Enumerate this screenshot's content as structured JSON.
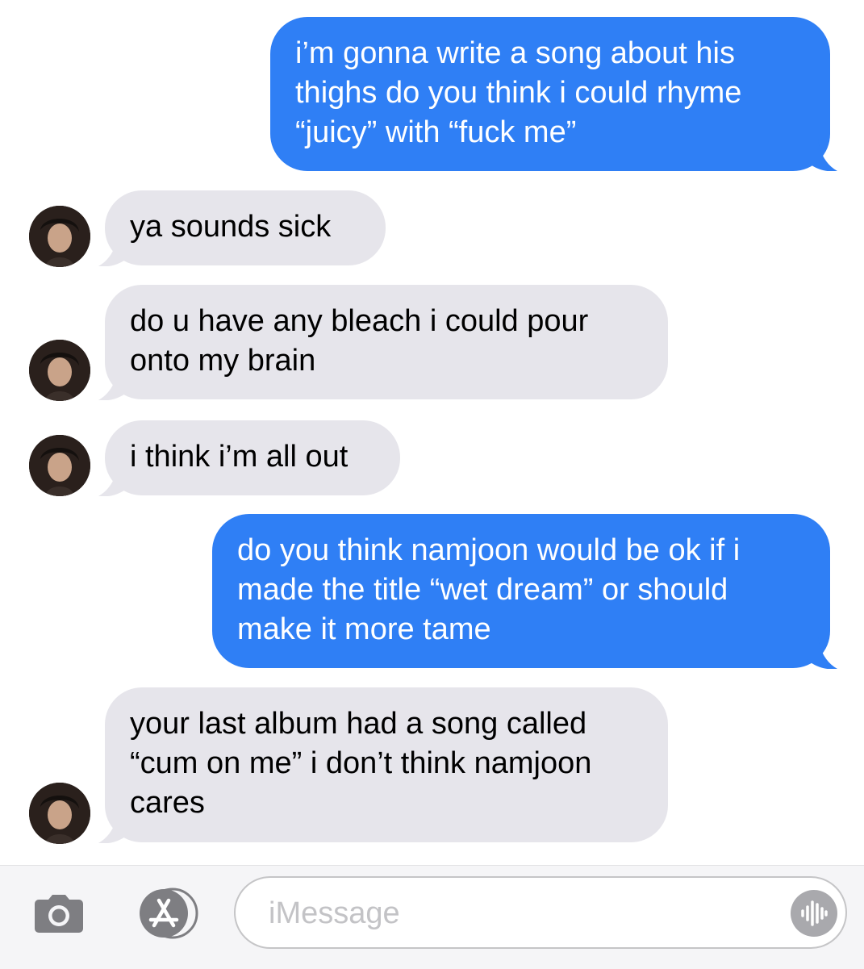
{
  "messages": [
    {
      "direction": "sent",
      "text": "i’m gonna write a song about his thighs do you think i could rhyme “juicy” with “fuck me”"
    },
    {
      "direction": "received",
      "text": "ya sounds sick"
    },
    {
      "direction": "received",
      "text": "do u have any bleach i could pour onto my brain"
    },
    {
      "direction": "received",
      "text": "i think i’m all out"
    },
    {
      "direction": "sent",
      "text": "do you think namjoon would be ok if i made the title “wet dream” or should make it more tame"
    },
    {
      "direction": "received",
      "text": "your last album had a song called “cum on me” i don’t think namjoon cares"
    }
  ],
  "input_bar": {
    "placeholder": "iMessage",
    "camera_icon": "camera-icon",
    "apps_icon": "app-store-icon",
    "audio_icon": "audio-waveform-icon"
  },
  "colors": {
    "sent_bubble": "#2f7ff5",
    "received_bubble": "#e6e5eb",
    "input_bar_bg": "#f5f5f7",
    "icon_gray": "#7e7e82"
  }
}
